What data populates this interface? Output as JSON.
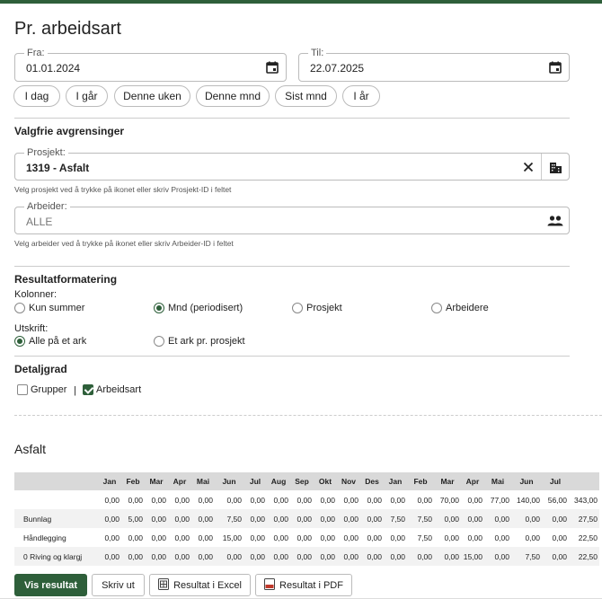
{
  "page_title": "Pr. arbeidsart",
  "date_from": {
    "label": "Fra:",
    "value": "01.01.2024",
    "icon": "calendar-icon"
  },
  "date_to": {
    "label": "Til:",
    "value": "22.07.2025",
    "icon": "calendar-icon"
  },
  "quick_ranges": [
    "I dag",
    "I går",
    "Denne uken",
    "Denne mnd",
    "Sist mnd",
    "I år"
  ],
  "filters": {
    "heading": "Valgfrie avgrensinger",
    "project": {
      "label": "Prosjekt:",
      "value": "1319 - Asfalt",
      "hint": "Velg prosjekt ved å trykke på ikonet eller skriv Prosjekt-ID i feltet",
      "clear_icon": "close-icon",
      "picker_icon": "building-icon"
    },
    "worker": {
      "label": "Arbeider:",
      "value": "ALLE",
      "hint": "Velg arbeider ved å trykke på ikonet eller skriv Arbeider-ID i feltet",
      "picker_icon": "people-icon"
    }
  },
  "formatting": {
    "heading": "Resultatformatering",
    "columns_label": "Kolonner:",
    "columns_options": [
      "Kun summer",
      "Mnd (periodisert)",
      "Prosjekt",
      "Arbeidere"
    ],
    "columns_selected": "Mnd (periodisert)",
    "output_label": "Utskrift:",
    "output_options": [
      "Alle på et ark",
      "Et ark pr. prosjekt"
    ],
    "output_selected": "Alle på et ark"
  },
  "detail": {
    "heading": "Detaljgrad",
    "groups_label": "Grupper",
    "groups_checked": false,
    "separator": "|",
    "workkind_label": "Arbeidsart",
    "workkind_checked": true
  },
  "result": {
    "title": "Asfalt",
    "headers": [
      "",
      "Jan",
      "Feb",
      "Mar",
      "Apr",
      "Mai",
      "Jun",
      "Jul",
      "Aug",
      "Sep",
      "Okt",
      "Nov",
      "Des",
      "Jan",
      "Feb",
      "Mar",
      "Apr",
      "Mai",
      "Jun",
      "Jul",
      ""
    ],
    "rows": [
      [
        "",
        "0,00",
        "0,00",
        "0,00",
        "0,00",
        "0,00",
        "0,00",
        "0,00",
        "0,00",
        "0,00",
        "0,00",
        "0,00",
        "0,00",
        "0,00",
        "0,00",
        "70,00",
        "0,00",
        "77,00",
        "140,00",
        "56,00",
        "343,00"
      ],
      [
        "Bunnlag",
        "0,00",
        "5,00",
        "0,00",
        "0,00",
        "0,00",
        "7,50",
        "0,00",
        "0,00",
        "0,00",
        "0,00",
        "0,00",
        "0,00",
        "7,50",
        "7,50",
        "0,00",
        "0,00",
        "0,00",
        "0,00",
        "0,00",
        "27,50"
      ],
      [
        "Håndlegging",
        "0,00",
        "0,00",
        "0,00",
        "0,00",
        "0,00",
        "15,00",
        "0,00",
        "0,00",
        "0,00",
        "0,00",
        "0,00",
        "0,00",
        "0,00",
        "7,50",
        "0,00",
        "0,00",
        "0,00",
        "0,00",
        "0,00",
        "22,50"
      ],
      [
        "0 Riving og klargj",
        "0,00",
        "0,00",
        "0,00",
        "0,00",
        "0,00",
        "0,00",
        "0,00",
        "0,00",
        "0,00",
        "0,00",
        "0,00",
        "0,00",
        "0,00",
        "0,00",
        "0,00",
        "15,00",
        "0,00",
        "7,50",
        "0,00",
        "22,50"
      ]
    ]
  },
  "actions": {
    "show": "Vis resultat",
    "print": "Skriv ut",
    "excel": "Resultat i Excel",
    "pdf": "Resultat i PDF"
  },
  "colors": {
    "accent": "#2e5f3a"
  }
}
